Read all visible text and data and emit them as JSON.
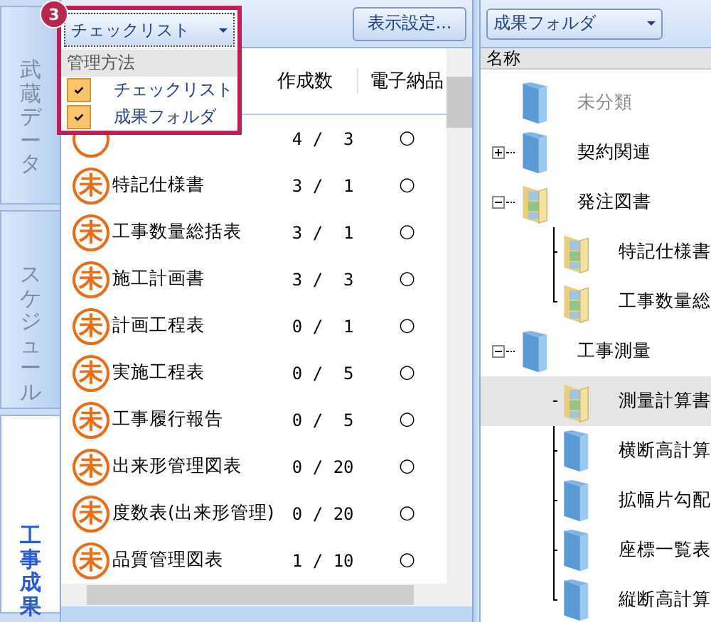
{
  "sidebar": {
    "tabs": [
      {
        "label": "武蔵データ",
        "selected": false
      },
      {
        "label": "スケジュール",
        "selected": false
      },
      {
        "label": "工事成果",
        "selected": true
      }
    ]
  },
  "checklist": {
    "settings_button": "表示設定...",
    "columns": [
      {
        "label": "作成数"
      },
      {
        "label": "電子納品"
      }
    ],
    "rows": [
      {
        "count": "4 /  3",
        "delivery": "○"
      },
      {
        "stamp": "未",
        "name": "特記仕様書",
        "count": "3 /  1",
        "delivery": "○"
      },
      {
        "stamp": "未",
        "name": "工事数量総括表",
        "count": "3 /  1",
        "delivery": "○"
      },
      {
        "stamp": "未",
        "name": "施工計画書",
        "count": "3 /  3",
        "delivery": "○"
      },
      {
        "stamp": "未",
        "name": "計画工程表",
        "count": "0 /  1",
        "delivery": "○"
      },
      {
        "stamp": "未",
        "name": "実施工程表",
        "count": "0 /  5",
        "delivery": "○"
      },
      {
        "stamp": "未",
        "name": "工事履行報告",
        "count": "0 /  5",
        "delivery": "○"
      },
      {
        "stamp": "未",
        "name": "出来形管理図表",
        "count": "0 / 20",
        "delivery": "○"
      },
      {
        "stamp": "未",
        "name": "度数表(出来形管理)",
        "count": "0 / 20",
        "delivery": "○"
      },
      {
        "stamp": "未",
        "name": "品質管理図表",
        "count": "1 / 10",
        "delivery": "○"
      }
    ]
  },
  "popup": {
    "badge": "3",
    "dropdown": "チェックリスト",
    "group": "管理方法",
    "items": [
      {
        "label": "チェックリスト",
        "checked": true
      },
      {
        "label": "成果フォルダ",
        "checked": true
      }
    ]
  },
  "folders": {
    "dropdown": "成果フォルダ",
    "column": "名称",
    "tree": [
      {
        "label": "未分類",
        "kind": "plain",
        "disabled": true
      },
      {
        "label": "契約関連",
        "kind": "plain",
        "expanded": false
      },
      {
        "label": "発注図書",
        "kind": "documents",
        "expanded": true,
        "children": [
          {
            "label": "特記仕様書",
            "kind": "documents",
            "selected": false
          },
          {
            "label": "工事数量総",
            "kind": "documents",
            "selected": false
          }
        ]
      },
      {
        "label": "工事測量",
        "kind": "plain",
        "expanded": true,
        "children": [
          {
            "label": "測量計算書",
            "kind": "documents",
            "selected": true
          },
          {
            "label": "横断高計算",
            "kind": "plain",
            "selected": false
          },
          {
            "label": "拡幅片勾配",
            "kind": "plain",
            "selected": false
          },
          {
            "label": "座標一覧表",
            "kind": "plain",
            "selected": false
          },
          {
            "label": "縦断高計算",
            "kind": "plain",
            "selected": false
          }
        ]
      }
    ]
  }
}
